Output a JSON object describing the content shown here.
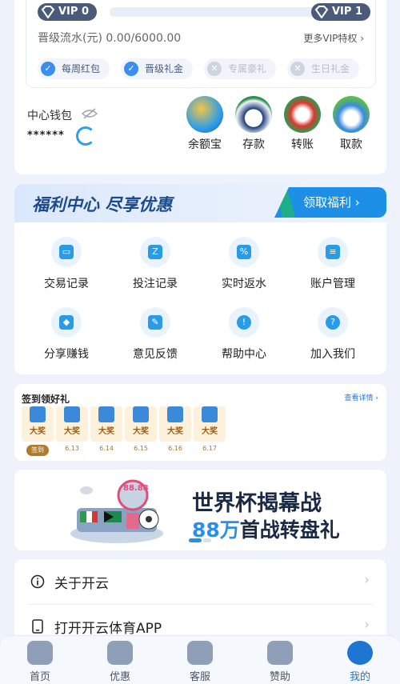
{
  "vip": {
    "current_level": "VIP 0",
    "next_level": "VIP 1",
    "progress": 0,
    "flow_text": "晋级流水(元) 0.00/6000.00",
    "more_link": "更多VIP特权",
    "perks": [
      {
        "label": "每周红包",
        "enabled": true
      },
      {
        "label": "晋级礼金",
        "enabled": true
      },
      {
        "label": "专属豪礼",
        "enabled": false
      },
      {
        "label": "生日礼金",
        "enabled": false
      }
    ]
  },
  "wallet": {
    "title": "中心钱包",
    "amount_masked": "******",
    "actions": [
      {
        "label": "余额宝",
        "icon": "piggy-bank-icon"
      },
      {
        "label": "存款",
        "icon": "deposit-ball-icon"
      },
      {
        "label": "转账",
        "icon": "transfer-ball-icon"
      },
      {
        "label": "取款",
        "icon": "withdraw-ball-icon"
      }
    ]
  },
  "welfare": {
    "title": "福利中心 尽享优惠",
    "claim_button": "领取福利",
    "items": [
      {
        "label": "交易记录",
        "icon": "wallet-icon",
        "glyph": "▭"
      },
      {
        "label": "投注记录",
        "icon": "calendar-icon",
        "glyph": "Z"
      },
      {
        "label": "实时返水",
        "icon": "percent-icon",
        "glyph": "%"
      },
      {
        "label": "账户管理",
        "icon": "id-card-icon",
        "glyph": "≡"
      },
      {
        "label": "分享赚钱",
        "icon": "share-icon",
        "glyph": "◆"
      },
      {
        "label": "意见反馈",
        "icon": "feedback-icon",
        "glyph": "✎"
      },
      {
        "label": "帮助中心",
        "icon": "help-icon",
        "glyph": "!"
      },
      {
        "label": "加入我们",
        "icon": "join-icon",
        "glyph": "?"
      }
    ]
  },
  "signin": {
    "title": "签到领好礼",
    "more": "查看详情",
    "days": [
      {
        "prize": "大奖",
        "date": "签到"
      },
      {
        "prize": "大奖",
        "date": "6.13"
      },
      {
        "prize": "大奖",
        "date": "6.14"
      },
      {
        "prize": "大奖",
        "date": "6.15"
      },
      {
        "prize": "大奖",
        "date": "6.16"
      },
      {
        "prize": "大奖",
        "date": "6.17"
      }
    ]
  },
  "banner": {
    "line1": "世界杯揭幕战",
    "highlight": "88万",
    "line2_rest": "首战转盘礼",
    "badge_text": "88.88"
  },
  "menu": [
    {
      "label": "关于开云",
      "icon": "info-icon"
    },
    {
      "label": "打开开云体育APP",
      "icon": "phone-icon"
    }
  ],
  "tabbar": [
    {
      "label": "首页",
      "icon": "home-icon",
      "active": false
    },
    {
      "label": "优惠",
      "icon": "gift-icon",
      "active": false
    },
    {
      "label": "客服",
      "icon": "headset-icon",
      "active": false
    },
    {
      "label": "赞助",
      "icon": "shield-icon",
      "active": false
    },
    {
      "label": "我的",
      "icon": "profile-icon",
      "active": true
    }
  ],
  "colors": {
    "accent": "#1f76d2",
    "primary_blue": "#2a9be6",
    "vip_badge": "#4a5a78"
  }
}
